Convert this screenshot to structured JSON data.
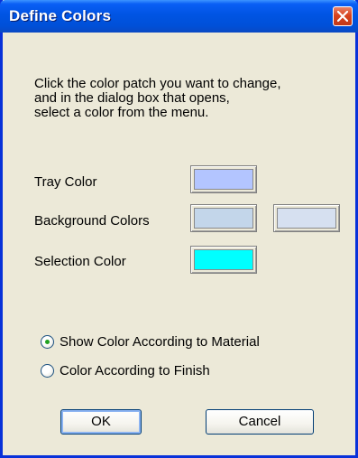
{
  "window": {
    "title": "Define Colors",
    "close_icon": "close-x-icon"
  },
  "instructions": {
    "lines": [
      "Click the color patch you want to change,",
      "and in the dialog box that opens,",
      "select a color from the menu."
    ]
  },
  "colors": {
    "tray_label": "Tray Color",
    "tray_color": "#b3c5ff",
    "background_label": "Background Colors",
    "background_color_1": "#c3d6ea",
    "background_color_2": "#d6e0f0",
    "selection_label": "Selection Color",
    "selection_color": "#00ffff"
  },
  "options": {
    "show_material_label": "Show Color According to Material",
    "show_material_selected": true,
    "finish_label": "Color According to Finish",
    "finish_selected": false
  },
  "buttons": {
    "ok_label": "OK",
    "cancel_label": "Cancel"
  }
}
